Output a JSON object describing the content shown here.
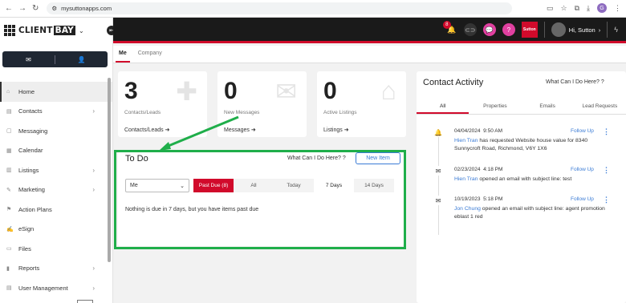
{
  "browser": {
    "url": "mysuttonapps.com"
  },
  "brand": {
    "name_part1": "CLIENT",
    "name_part2": "BAY"
  },
  "sidebar": {
    "items": [
      {
        "label": "Home",
        "icon": "home-icon",
        "has_arrow": false
      },
      {
        "label": "Contacts",
        "icon": "contacts-icon",
        "has_arrow": true
      },
      {
        "label": "Messaging",
        "icon": "chat-icon",
        "has_arrow": false
      },
      {
        "label": "Calendar",
        "icon": "calendar-icon",
        "has_arrow": false
      },
      {
        "label": "Listings",
        "icon": "listings-icon",
        "has_arrow": true
      },
      {
        "label": "Marketing",
        "icon": "marketing-icon",
        "has_arrow": true
      },
      {
        "label": "Action Plans",
        "icon": "action-plans-icon",
        "has_arrow": false
      },
      {
        "label": "eSign",
        "icon": "esign-icon",
        "has_arrow": false
      },
      {
        "label": "Files",
        "icon": "files-icon",
        "has_arrow": false
      },
      {
        "label": "Reports",
        "icon": "reports-icon",
        "has_arrow": true
      },
      {
        "label": "User Management",
        "icon": "users-icon",
        "has_arrow": true
      }
    ]
  },
  "topbar": {
    "notification_count": "8",
    "sutton_logo": "Sutton",
    "greeting": "Hi, Sutton"
  },
  "tabs": {
    "me": "Me",
    "company": "Company"
  },
  "stats": [
    {
      "value": "3",
      "label": "Contacts/Leads",
      "link": "Contacts/Leads"
    },
    {
      "value": "0",
      "label": "New Messages",
      "link": "Messages"
    },
    {
      "value": "0",
      "label": "Active Listings",
      "link": "Listings"
    }
  ],
  "todo": {
    "title": "To Do",
    "help": "What Can I Do Here?",
    "new_item": "New Item",
    "select_value": "Me",
    "filters": [
      "Past Due (8)",
      "All",
      "Today",
      "7 Days",
      "14 Days"
    ],
    "message": "Nothing is due in 7 days, but you have items past due"
  },
  "contact_activity": {
    "title": "Contact Activity",
    "help": "What Can I Do Here?",
    "tabs": [
      "All",
      "Properties",
      "Emails",
      "Lead Requests"
    ],
    "items": [
      {
        "date": "04/04/2024",
        "time": "9:50 AM",
        "name": "Hien Tran",
        "text": " has requested Website house value for 8340 Sunnycroft Road, Richmond, V6Y 1X6",
        "follow_up": "Follow Up",
        "icon": "bell-icon"
      },
      {
        "date": "02/23/2024",
        "time": "4:18 PM",
        "name": "Hien Tran",
        "text": " opened an email with subject line: test",
        "follow_up": "Follow Up",
        "icon": "envelope-icon"
      },
      {
        "date": "10/19/2023",
        "time": "5:18 PM",
        "name": "Jon Chung",
        "text": " opened an email with subject line: agent promotion eblast 1 red",
        "follow_up": "Follow Up",
        "icon": "envelope-icon"
      }
    ]
  },
  "colors": {
    "accent": "#d10a2b",
    "highlight": "#1fae4a",
    "link": "#3a7bd5"
  }
}
